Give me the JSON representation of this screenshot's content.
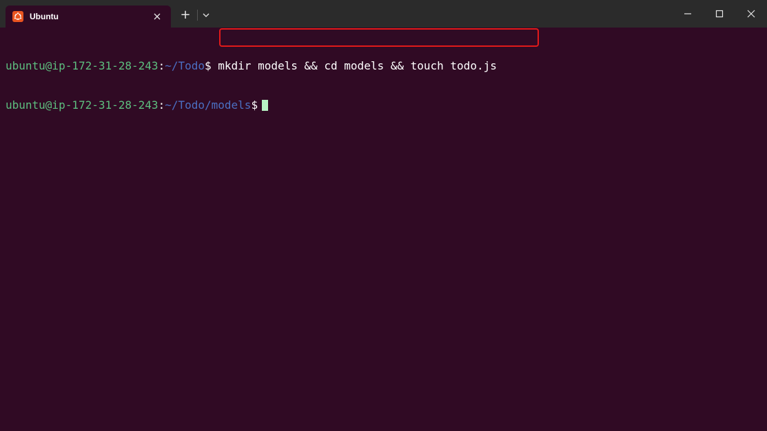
{
  "tab": {
    "title": "Ubuntu",
    "icon": "ubuntu-logo-icon",
    "close_icon": "close-icon"
  },
  "titlebar": {
    "new_tab_label": "+",
    "dropdown_icon": "chevron-down-icon",
    "minimize_icon": "minimize-icon",
    "maximize_icon": "maximize-icon",
    "close_icon": "close-icon"
  },
  "terminal": {
    "lines": [
      {
        "user_host": "ubuntu@ip-172-31-28-243",
        "colon": ":",
        "path": "~/Todo",
        "prompt": "$ ",
        "command": "mkdir models && cd models && touch todo.js"
      },
      {
        "user_host": "ubuntu@ip-172-31-28-243",
        "colon": ":",
        "path": "~/Todo/models",
        "prompt": "$",
        "command": ""
      }
    ]
  },
  "colors": {
    "background": "#300a24",
    "titlebar": "#2b2b2b",
    "user_host": "#5dbf7f",
    "path": "#4b6fc2",
    "highlight_box": "#e11a1a",
    "cursor": "#b7f3c4",
    "ubuntu_orange": "#e95420"
  }
}
